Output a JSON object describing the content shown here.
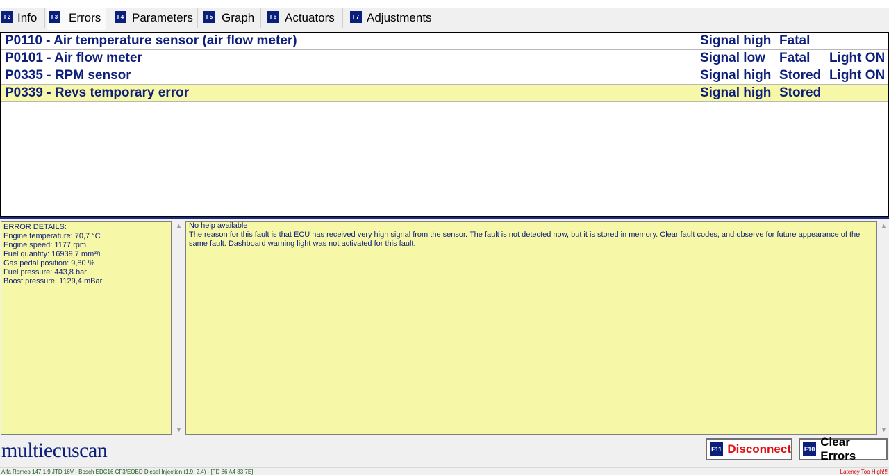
{
  "tabs": [
    {
      "key": "F2",
      "label": "Info"
    },
    {
      "key": "F3",
      "label": "Errors"
    },
    {
      "key": "F4",
      "label": "Parameters"
    },
    {
      "key": "F5",
      "label": "Graph"
    },
    {
      "key": "F6",
      "label": "Actuators"
    },
    {
      "key": "F7",
      "label": "Adjustments"
    }
  ],
  "errors": [
    {
      "desc": "P0110 - Air temperature sensor (air flow meter)",
      "signal": "Signal high",
      "status": "Fatal",
      "light": ""
    },
    {
      "desc": "P0101 - Air flow meter",
      "signal": "Signal low",
      "status": "Fatal",
      "light": "Light ON"
    },
    {
      "desc": "P0335 - RPM sensor",
      "signal": "Signal high",
      "status": "Stored",
      "light": "Light ON"
    },
    {
      "desc": "P0339 - Revs temporary error",
      "signal": "Signal high",
      "status": "Stored",
      "light": ""
    }
  ],
  "details": {
    "title": "ERROR DETAILS:",
    "lines": [
      "Engine temperature: 70,7 °C",
      "Engine speed: 1177 rpm",
      "Fuel quantity: 16939,7 mm³/i",
      "Gas pedal position: 9,80 %",
      "Fuel pressure: 443,8 bar",
      "Boost pressure: 1129,4 mBar"
    ]
  },
  "help": {
    "title": "No help available",
    "text": "The reason for this fault is that ECU has received very high signal from the sensor. The fault is not detected now, but it is stored in memory. Clear fault codes, and observe for future appearance of the same fault. Dashboard warning light was not activated for this fault."
  },
  "logo": "multiecuscan",
  "buttons": {
    "disconnect": {
      "key": "F11",
      "label": "Disconnect",
      "color": "#e01010"
    },
    "clear": {
      "key": "F10",
      "label": "Clear Errors",
      "color": "#000000"
    }
  },
  "status": {
    "left": "Alfa Romeo 147 1.9 JTD 16V - Bosch EDC16 CF3/EOBD Diesel Injection (1.9, 2.4) - [FD 86 A4 83 7E]",
    "right": "Latency Too High!!!"
  },
  "colors": {
    "accent": "#0a1e7c",
    "highlight": "#f7f7a8",
    "text": "#0d1f7a"
  }
}
